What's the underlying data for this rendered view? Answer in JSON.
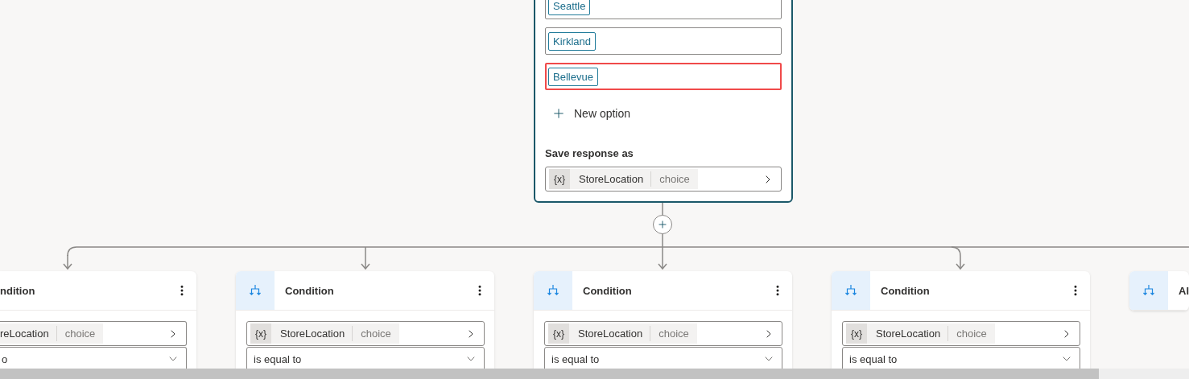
{
  "question_card": {
    "options": [
      {
        "label": "Seattle",
        "highlighted": false
      },
      {
        "label": "Kirkland",
        "highlighted": false
      },
      {
        "label": "Bellevue",
        "highlighted": true
      }
    ],
    "new_option": "New option",
    "save_label": "Save response as",
    "variable": {
      "var_icon": "{x}",
      "name": "StoreLocation",
      "type": "choice"
    }
  },
  "conditions": [
    {
      "kind": "clipped",
      "title": "ndition",
      "variable": {
        "name": "reLocation",
        "type": "choice"
      },
      "operator": "o"
    },
    {
      "kind": "full",
      "title": "Condition",
      "variable": {
        "var_icon": "{x}",
        "name": "StoreLocation",
        "type": "choice"
      },
      "operator": "is equal to"
    },
    {
      "kind": "full",
      "title": "Condition",
      "variable": {
        "var_icon": "{x}",
        "name": "StoreLocation",
        "type": "choice"
      },
      "operator": "is equal to"
    },
    {
      "kind": "full",
      "title": "Condition",
      "variable": {
        "var_icon": "{x}",
        "name": "StoreLocation",
        "type": "choice"
      },
      "operator": "is equal to"
    },
    {
      "kind": "collapsed",
      "title": "Al"
    }
  ]
}
